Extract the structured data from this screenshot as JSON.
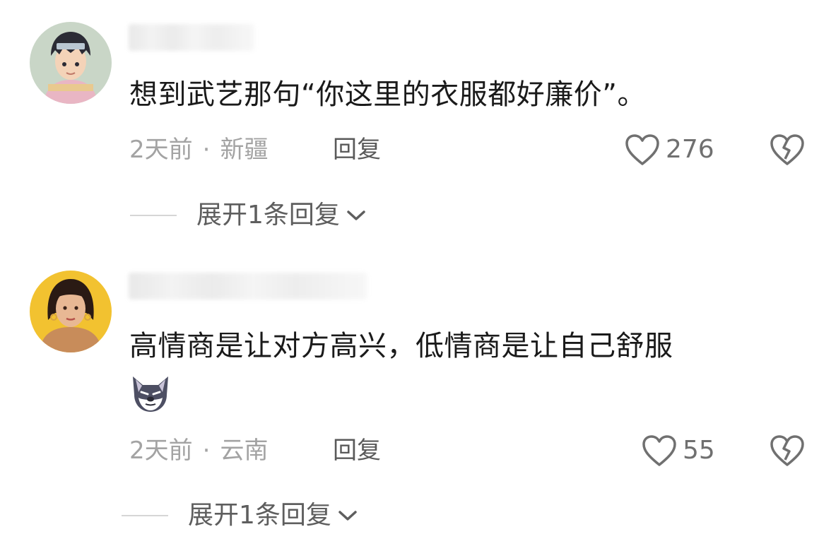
{
  "comments": [
    {
      "text": "想到武艺那句“你这里的衣服都好廉价”。",
      "time": "2天前",
      "location": "新疆",
      "separator": "·",
      "reply_label": "回复",
      "likes": "276",
      "expand_label": "展开1条回复"
    },
    {
      "text": "高情商是让对方高兴，低情商是让自己舒服",
      "time": "2天前",
      "location": "云南",
      "separator": "·",
      "reply_label": "回复",
      "likes": "55",
      "expand_label": "展开1条回复",
      "emoji": "wolf-face-emoji"
    }
  ],
  "icons": {
    "like": "heart-outline-icon",
    "dislike": "broken-heart-icon",
    "expand": "chevron-down-icon"
  },
  "colors": {
    "text": "#1a1a1a",
    "meta": "#a3a3a3",
    "reply": "#5a5a5a",
    "icon": "#707070"
  }
}
